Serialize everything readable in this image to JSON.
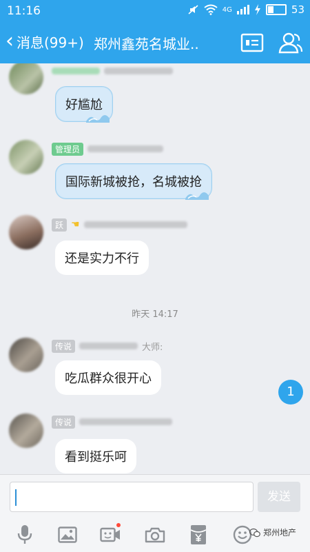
{
  "status_bar": {
    "time": "11:16",
    "signal": "4G",
    "battery": "53"
  },
  "header": {
    "back_label": "消息(99+)",
    "title": "郑州鑫苑名城业.."
  },
  "messages": [
    {
      "text": "好尴尬"
    },
    {
      "badge": "管理员",
      "text": "国际新城被抢，名城被抢"
    },
    {
      "badge": "跃",
      "text": "还是实力不行"
    },
    {
      "timestamp": "昨天 14:17"
    },
    {
      "badge": "传说",
      "name_suffix": "大师:",
      "text": "吃瓜群众很开心"
    },
    {
      "badge": "传说",
      "text": "看到挺乐呵"
    }
  ],
  "unread_badge": "1",
  "composer": {
    "send_label": "发送"
  },
  "watermark": "郑州地产",
  "colors": {
    "accent": "#2fa5ec",
    "admin_badge": "#6ecb8f",
    "member_badge": "#c7c9cd"
  },
  "toolbar_icons": [
    "mic-icon",
    "image-icon",
    "video-icon",
    "camera-icon",
    "red-packet-icon",
    "emoji-icon",
    "more-icon"
  ]
}
